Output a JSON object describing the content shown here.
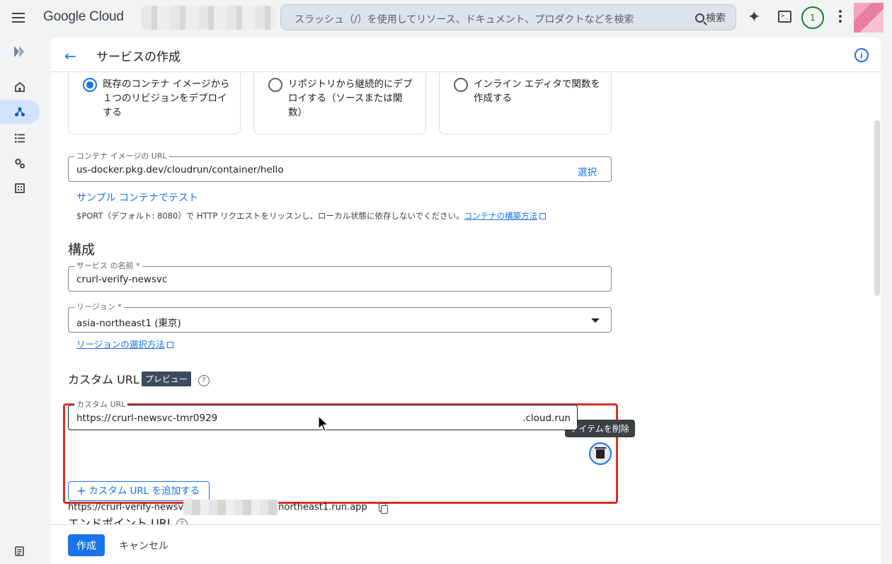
{
  "topbar": {
    "logo": "Google Cloud",
    "search_placeholder": "スラッシュ（/）を使用してリソース、ドキュメント、プロダクトなどを検索",
    "search_button": "検索",
    "notification_count": "1"
  },
  "header": {
    "title": "サービスの作成"
  },
  "deploy_options": [
    {
      "label": "既存のコンテナ イメージから１つのリビジョンをデプロイする",
      "selected": true
    },
    {
      "label": "リポジトリから継続的にデプロイする（ソースまたは関数）",
      "selected": false
    },
    {
      "label": "インライン エディタで関数を作成する",
      "selected": false
    }
  ],
  "container": {
    "label": "コンテナ イメージの URL",
    "value": "us-docker.pkg.dev/cloudrun/container/hello",
    "select": "選択",
    "test_link": "サンプル コンテナでテスト",
    "hint": "$PORT（デフォルト: 8080）で HTTP リクエストをリッスンし、ローカル状態に依存しないでください。",
    "hint_link": "コンテナの構築方法"
  },
  "config": {
    "title": "構成",
    "service_name_label": "サービス の名前 *",
    "service_name_value": "crurl-verify-newsvc",
    "region_label": "リージョン *",
    "region_value": "asia-northeast1 (東京)",
    "region_link": "リージョンの選択方法"
  },
  "custom_url": {
    "title": "カスタム URL",
    "badge": "プレビュー",
    "field_label": "カスタム URL",
    "prefix": "https://",
    "value": "crurl-newsvc-tmr0929",
    "suffix": ".cloud.run",
    "tooltip": "アイテムを削除",
    "add_button": "カスタム URL を追加する"
  },
  "endpoint": {
    "title": "エンドポイント URL",
    "url_start": "https://crurl-verify-newsv",
    "url_end": "northeast1.run.app"
  },
  "footer": {
    "create": "作成",
    "cancel": "キャンセル"
  },
  "colors": {
    "accent": "#1a73e8",
    "highlight": "#d93025",
    "badge": "#3c4a5e"
  }
}
